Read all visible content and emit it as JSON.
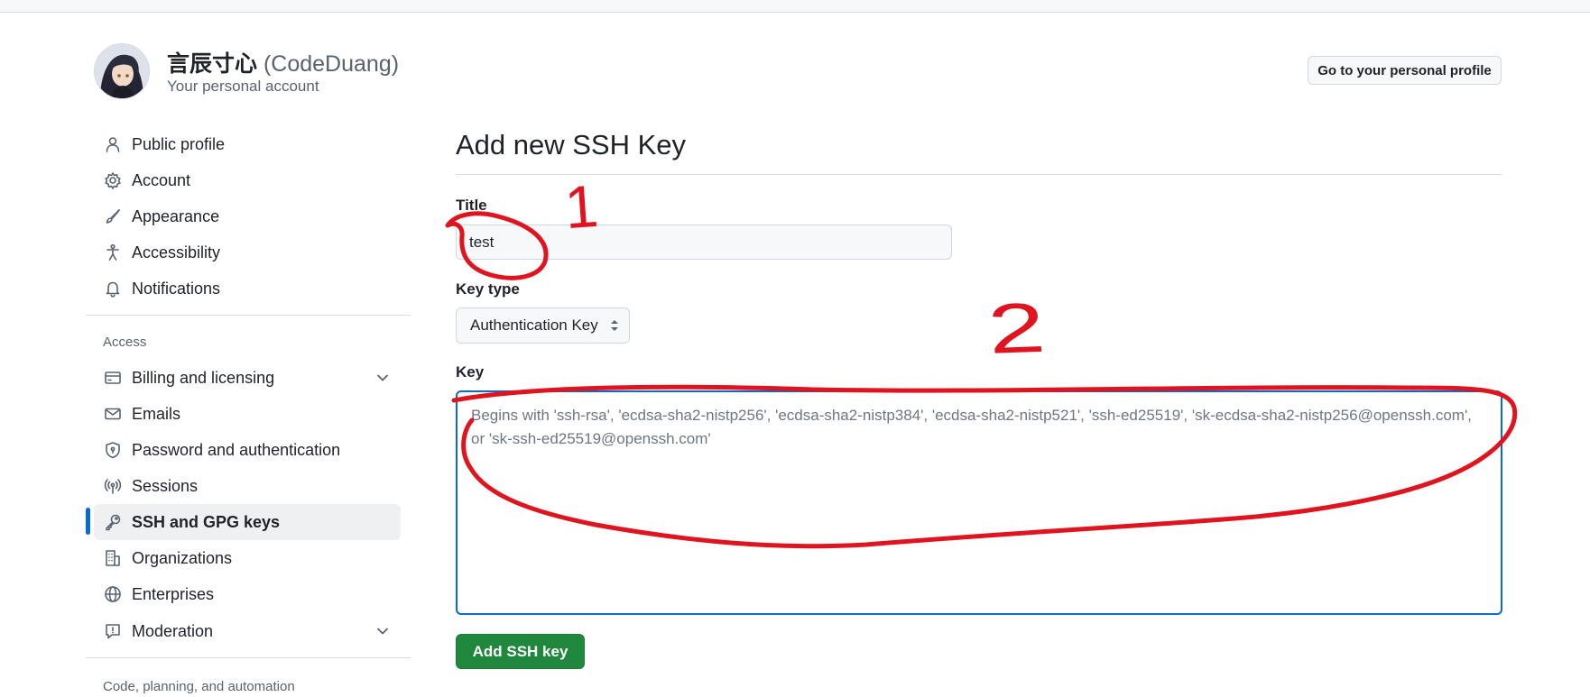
{
  "header": {
    "display_name": "言辰寸心",
    "login": "(CodeDuang)",
    "subtitle": "Your personal account",
    "profile_button": "Go to your personal profile"
  },
  "sidebar": {
    "items": [
      {
        "label": "Public profile",
        "icon": "person-icon"
      },
      {
        "label": "Account",
        "icon": "gear-icon"
      },
      {
        "label": "Appearance",
        "icon": "paintbrush-icon"
      },
      {
        "label": "Accessibility",
        "icon": "accessibility-icon"
      },
      {
        "label": "Notifications",
        "icon": "bell-icon"
      }
    ],
    "access_heading": "Access",
    "access_items": [
      {
        "label": "Billing and licensing",
        "icon": "credit-card-icon"
      },
      {
        "label": "Emails",
        "icon": "mail-icon"
      },
      {
        "label": "Password and authentication",
        "icon": "shield-lock-icon"
      },
      {
        "label": "Sessions",
        "icon": "broadcast-icon"
      },
      {
        "label": "SSH and GPG keys",
        "icon": "key-icon",
        "active": true
      },
      {
        "label": "Organizations",
        "icon": "organization-icon"
      },
      {
        "label": "Enterprises",
        "icon": "globe-icon"
      },
      {
        "label": "Moderation",
        "icon": "report-icon"
      }
    ],
    "code_heading": "Code, planning, and automation"
  },
  "form": {
    "page_title": "Add new SSH Key",
    "title_label": "Title",
    "title_value": "test",
    "key_type_label": "Key type",
    "key_type_value": "Authentication Key",
    "key_label": "Key",
    "key_placeholder": "Begins with 'ssh-rsa', 'ecdsa-sha2-nistp256', 'ecdsa-sha2-nistp384', 'ecdsa-sha2-nistp521', 'ssh-ed25519', 'sk-ecdsa-sha2-nistp256@openssh.com', or 'sk-ssh-ed25519@openssh.com'",
    "submit_label": "Add SSH key"
  },
  "annotations": {
    "mark_1": "1",
    "mark_2": "2",
    "color": "#e0141e"
  },
  "colors": {
    "accent": "#0969da",
    "primary_button": "#1f883d"
  }
}
